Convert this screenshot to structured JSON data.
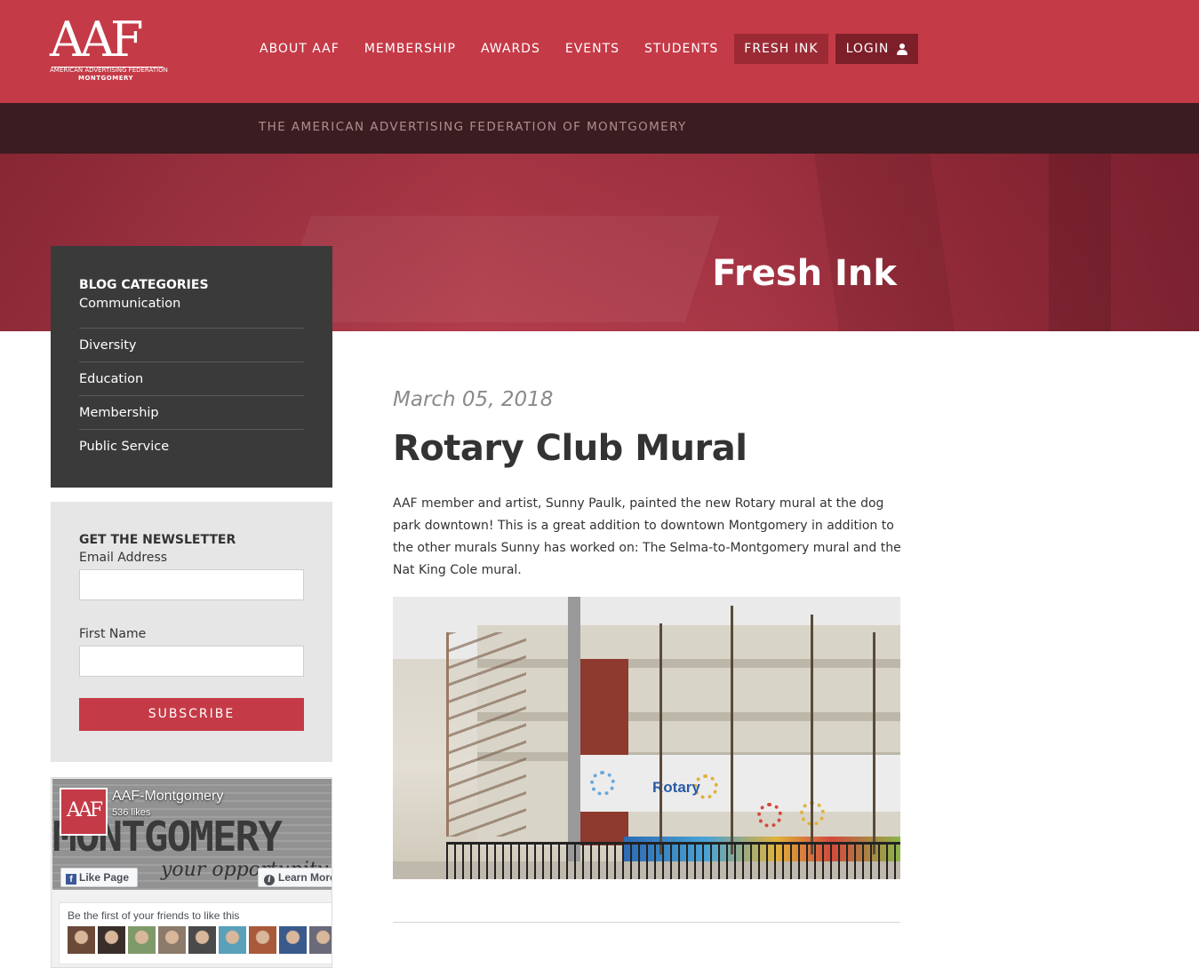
{
  "header": {
    "logo_mark": "AAF",
    "logo_line1": "AMERICAN ADVERTISING FEDERATION",
    "logo_line2": "MONTGOMERY",
    "nav": {
      "about": "ABOUT AAF",
      "membership": "MEMBERSHIP",
      "awards": "AWARDS",
      "events": "EVENTS",
      "students": "STUDENTS",
      "fresh_ink": "FRESH INK",
      "login": "LOGIN"
    },
    "tagline": "THE AMERICAN ADVERTISING FEDERATION OF MONTGOMERY",
    "active_nav": "fresh_ink"
  },
  "hero": {
    "title": "Fresh Ink"
  },
  "sidebar": {
    "categories": {
      "heading": "BLOG CATEGORIES",
      "items": [
        "Communication",
        "Diversity",
        "Education",
        "Membership",
        "Public Service"
      ]
    },
    "newsletter": {
      "heading": "GET THE NEWSLETTER",
      "email_label": "Email Address",
      "email_value": "",
      "first_name_label": "First Name",
      "first_name_value": "",
      "subscribe_label": "SUBSCRIBE"
    },
    "facebook": {
      "avatar_text": "AAF",
      "page_name": "AAF-Montgomery",
      "likes": "536 likes",
      "cover_word": "MONTGOMERY",
      "cover_script": "your opportunity",
      "like_button": "Like Page",
      "learn_button": "Learn More",
      "friends_text": "Be the first of your friends to like this",
      "friend_face_colors": [
        "#6b4a3a",
        "#3a2e2a",
        "#7f9a6a",
        "#8c7a6a",
        "#4a4a4a",
        "#5aa0b8",
        "#a85a3a",
        "#3a5a8c",
        "#6a6a7a",
        "#8a3a2a"
      ]
    }
  },
  "article": {
    "date": "March 05, 2018",
    "title": "Rotary Club Mural",
    "body": "AAF member and artist, Sunny Paulk, painted the new Rotary mural at the dog park downtown! This is a great addition to downtown Montgomery in addition to the other murals Sunny has worked on: The Selma-to-Montgomery mural and the Nat King Cole mural.",
    "photo_mural_text": "Rotary"
  },
  "colors": {
    "brand_red": "#c53a47",
    "dark_band": "#3b1c20",
    "sidebar_dark": "#3a3a3a",
    "active_nav": "#9c2a35",
    "login_bg": "#7d1f29"
  }
}
